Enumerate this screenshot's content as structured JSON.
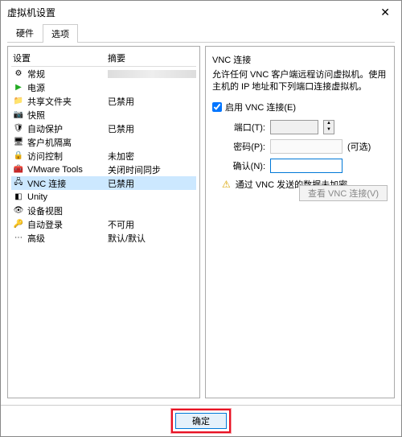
{
  "window": {
    "title": "虚拟机设置"
  },
  "tabs": {
    "hardware": "硬件",
    "options": "选项"
  },
  "left": {
    "header_setting": "设置",
    "header_summary": "摘要",
    "items": [
      {
        "icon": "gear-icon",
        "label": "常规",
        "summary": ""
      },
      {
        "icon": "power-icon",
        "color": "#2a2",
        "label": "电源",
        "summary": ""
      },
      {
        "icon": "folder-icon",
        "label": "共享文件夹",
        "summary": "已禁用"
      },
      {
        "icon": "camera-icon",
        "label": "快照",
        "summary": ""
      },
      {
        "icon": "shield-icon",
        "label": "自动保护",
        "summary": "已禁用"
      },
      {
        "icon": "isolate-icon",
        "label": "客户机隔离",
        "summary": ""
      },
      {
        "icon": "lock-icon",
        "label": "访问控制",
        "summary": "未加密"
      },
      {
        "icon": "tools-icon",
        "label": "VMware Tools",
        "summary": "关闭时间同步"
      },
      {
        "icon": "vnc-icon",
        "label": "VNC 连接",
        "summary": "已禁用"
      },
      {
        "icon": "unity-icon",
        "label": "Unity",
        "summary": ""
      },
      {
        "icon": "view-icon",
        "label": "设备视图",
        "summary": ""
      },
      {
        "icon": "login-icon",
        "label": "自动登录",
        "summary": "不可用"
      },
      {
        "icon": "advanced-icon",
        "label": "高级",
        "summary": "默认/默认"
      }
    ],
    "selected_index": 8
  },
  "right": {
    "title": "VNC 连接",
    "desc1": "允许任何 VNC 客户端远程访问虚拟机。使用主机的 IP 地址和下列端口连接虚拟机。",
    "enable_label": "启用 VNC 连接(E)",
    "enable_checked": true,
    "port_label": "端口(T):",
    "port_value": "",
    "password_label": "密码(P):",
    "password_value": "",
    "password_optional": "(可选)",
    "confirm_label": "确认(N):",
    "confirm_value": "",
    "warn_text": "通过 VNC 发送的数据未加密。",
    "view_button": "查看 VNC 连接(V)"
  },
  "footer": {
    "ok": "确定"
  }
}
